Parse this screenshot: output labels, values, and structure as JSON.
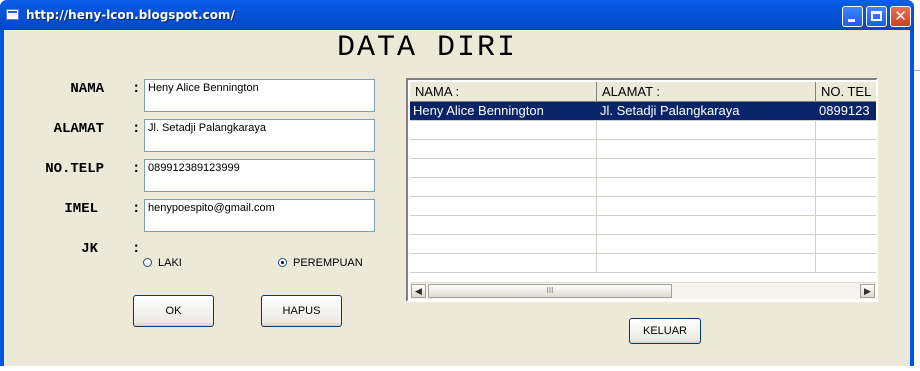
{
  "window": {
    "title": "http://heny-lcon.blogspot.com/",
    "colors": {
      "titlebar": "#0553d9",
      "client": "#ece9d8",
      "selection": "#0a246a"
    }
  },
  "form": {
    "heading": "DATA DIRI",
    "colon": ":",
    "fields": {
      "nama": {
        "label": "NAMA",
        "value": "Heny Alice Bennington"
      },
      "alamat": {
        "label": "ALAMAT",
        "value": "Jl. Setadji Palangkaraya"
      },
      "notelp": {
        "label": "NO.TELP",
        "value": "089912389123999"
      },
      "imel": {
        "label": "IMEL",
        "value": "henypoespito@gmail.com"
      }
    },
    "jk": {
      "label": "JK",
      "options": {
        "laki": "LAKI",
        "perempuan": "PEREMPUAN"
      },
      "selected": "PEREMPUAN"
    },
    "buttons": {
      "ok": "OK",
      "hapus": "HAPUS",
      "keluar": "KELUAR"
    }
  },
  "grid": {
    "columns": [
      "NAMA :",
      "ALAMAT :",
      "NO. TEL"
    ],
    "rows": [
      [
        "Heny Alice Bennington",
        "Jl. Setadji Palangkaraya",
        "0899123"
      ]
    ],
    "scroll_left_icon": "arrow-left-icon",
    "scroll_right_icon": "arrow-right-icon",
    "thumb_grip": "III"
  }
}
